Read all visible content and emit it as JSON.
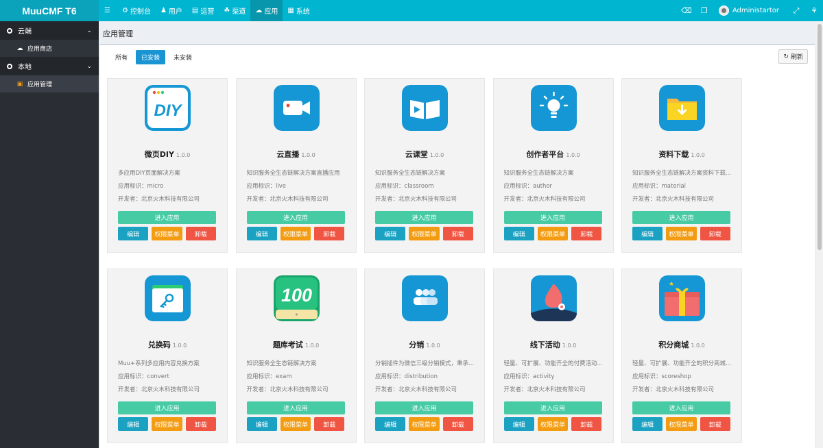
{
  "brand": "MuuCMF T6",
  "nav": [
    {
      "icon": "menu-icon",
      "label": ""
    },
    {
      "icon": "dashboard-icon",
      "label": "控制台"
    },
    {
      "icon": "user-icon",
      "label": "用户"
    },
    {
      "icon": "chart-icon",
      "label": "运营"
    },
    {
      "icon": "channel-icon",
      "label": "渠道"
    },
    {
      "icon": "cloud-icon",
      "label": "应用"
    },
    {
      "icon": "system-icon",
      "label": "系统"
    }
  ],
  "user": {
    "name": "Administartor"
  },
  "sidebar": {
    "groups": [
      {
        "label": "云端",
        "items": [
          {
            "label": "应用商店"
          }
        ]
      },
      {
        "label": "本地",
        "items": [
          {
            "label": "应用管理"
          }
        ]
      }
    ]
  },
  "page_title": "应用管理",
  "tabs": [
    "所有",
    "已安装",
    "未安装"
  ],
  "refresh_label": "刷新",
  "labels": {
    "id_prefix": "应用标识：",
    "publisher_prefix": "开发者：",
    "enter": "进入应用",
    "edit": "编辑",
    "perm": "权限菜单",
    "uninstall": "卸载"
  },
  "apps": [
    {
      "title": "微页DIY",
      "version": "1.0.0",
      "desc": "多应用DIY页面解决方案",
      "id": "micro",
      "publisher": "北京火木科技有限公司",
      "icon": "diy-icon"
    },
    {
      "title": "云直播",
      "version": "1.0.0",
      "desc": "知识服务全生态链解决方案直播应用",
      "id": "live",
      "publisher": "北京火木科技有限公司",
      "icon": "video-camera-icon"
    },
    {
      "title": "云课堂",
      "version": "1.0.0",
      "desc": "知识服务全生态链解决方案",
      "id": "classroom",
      "publisher": "北京火木科技有限公司",
      "icon": "book-play-icon"
    },
    {
      "title": "创作者平台",
      "version": "1.0.0",
      "desc": "知识服务全生态链解决方案",
      "id": "author",
      "publisher": "北京火木科技有限公司",
      "icon": "lightbulb-icon"
    },
    {
      "title": "资料下载",
      "version": "1.0.0",
      "desc": "知识服务全生态链解决方案资料下载...",
      "id": "material",
      "publisher": "北京火木科技有限公司",
      "icon": "folder-download-icon"
    },
    {
      "title": "兑换码",
      "version": "1.0.0",
      "desc": "Muu+系列多应用内容兑换方案",
      "id": "convert",
      "publisher": "北京火木科技有限公司",
      "icon": "key-card-icon"
    },
    {
      "title": "题库考试",
      "version": "1.0.0",
      "desc": "知识服务全生态链解决方案",
      "id": "exam",
      "publisher": "北京火木科技有限公司",
      "icon": "score-100-icon"
    },
    {
      "title": "分销",
      "version": "1.0.0",
      "desc": "分销插件为微信三级分销模式，秉承...",
      "id": "distribution",
      "publisher": "北京火木科技有限公司",
      "icon": "people-group-icon"
    },
    {
      "title": "线下活动",
      "version": "1.0.0",
      "desc": "轻量、可扩展、功能齐全的付费活动...",
      "id": "activity",
      "publisher": "北京火木科技有限公司",
      "icon": "activity-flame-icon"
    },
    {
      "title": "积分商城",
      "version": "1.0.0",
      "desc": "轻量、可扩展、功能齐全的积分商城...",
      "id": "scoreshop",
      "publisher": "北京火木科技有限公司",
      "icon": "gift-box-icon"
    }
  ],
  "colors": {
    "header": "#00b5d0",
    "sidebar": "#2a2d33",
    "enter_button": "#47cba5",
    "edit_button": "#1ba2c2",
    "perm_button": "#f39c12",
    "uninstall_button": "#f05442",
    "active_tab": "#1a95d4"
  }
}
